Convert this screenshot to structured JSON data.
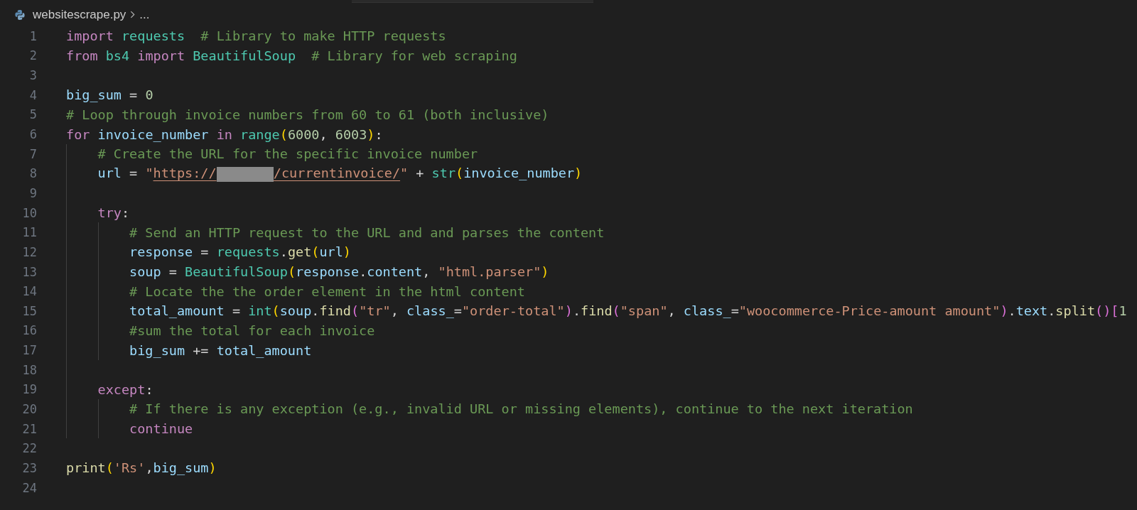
{
  "breadcrumb": {
    "file": "websitescrape.py",
    "more": "..."
  },
  "lines": [
    {
      "number": "1",
      "tokens": [
        {
          "kind": "kw",
          "text": "import "
        },
        {
          "kind": "cls",
          "text": "requests  "
        },
        {
          "kind": "comment",
          "text": "# Library to make HTTP requests"
        }
      ]
    },
    {
      "number": "2",
      "tokens": [
        {
          "kind": "kw",
          "text": "from "
        },
        {
          "kind": "cls",
          "text": "bs4 "
        },
        {
          "kind": "kw",
          "text": "import "
        },
        {
          "kind": "cls",
          "text": "BeautifulSoup  "
        },
        {
          "kind": "comment",
          "text": "# Library for web scraping"
        }
      ]
    },
    {
      "number": "3"
    },
    {
      "number": "4",
      "tokens": [
        {
          "kind": "var",
          "text": "big_sum"
        },
        {
          "kind": "plain",
          "text": " = "
        },
        {
          "kind": "num",
          "text": "0"
        }
      ]
    },
    {
      "number": "5",
      "tokens": [
        {
          "kind": "comment",
          "text": "# Loop through invoice numbers from 60 to 61 (both inclusive)"
        }
      ]
    },
    {
      "number": "6",
      "tokens": [
        {
          "kind": "kw",
          "text": "for "
        },
        {
          "kind": "var",
          "text": "invoice_number "
        },
        {
          "kind": "kw",
          "text": "in "
        },
        {
          "kind": "cls",
          "text": "range"
        },
        {
          "kind": "br1",
          "text": "("
        },
        {
          "kind": "num",
          "text": "6000"
        },
        {
          "kind": "plain",
          "text": ", "
        },
        {
          "kind": "num",
          "text": "6003"
        },
        {
          "kind": "br1",
          "text": ")"
        },
        {
          "kind": "plain",
          "text": ":"
        }
      ],
      "children": [
        {
          "number": "7",
          "tokens": [
            {
              "kind": "comment",
              "text": "# Create the URL for the specific invoice number"
            }
          ]
        },
        {
          "number": "8",
          "tokens": [
            {
              "kind": "var",
              "text": "url"
            },
            {
              "kind": "plain",
              "text": " = "
            },
            {
              "kind": "str",
              "text": "\""
            },
            {
              "kind": "url",
              "text": "https://"
            },
            {
              "kind": "redacted"
            },
            {
              "kind": "url",
              "text": "/currentinvoice/"
            },
            {
              "kind": "str",
              "text": "\""
            },
            {
              "kind": "plain",
              "text": " + "
            },
            {
              "kind": "cls",
              "text": "str"
            },
            {
              "kind": "br1",
              "text": "("
            },
            {
              "kind": "var",
              "text": "invoice_number"
            },
            {
              "kind": "br1",
              "text": ")"
            }
          ]
        },
        {
          "number": "9"
        },
        {
          "number": "10",
          "tokens": [
            {
              "kind": "kw",
              "text": "try"
            },
            {
              "kind": "plain",
              "text": ":"
            }
          ],
          "children": [
            {
              "number": "11",
              "tokens": [
                {
                  "kind": "comment",
                  "text": "# Send an HTTP request to the URL and and parses the content"
                }
              ]
            },
            {
              "number": "12",
              "tokens": [
                {
                  "kind": "var",
                  "text": "response"
                },
                {
                  "kind": "plain",
                  "text": " = "
                },
                {
                  "kind": "cls",
                  "text": "requests"
                },
                {
                  "kind": "plain",
                  "text": "."
                },
                {
                  "kind": "fn",
                  "text": "get"
                },
                {
                  "kind": "br1",
                  "text": "("
                },
                {
                  "kind": "var",
                  "text": "url"
                },
                {
                  "kind": "br1",
                  "text": ")"
                }
              ]
            },
            {
              "number": "13",
              "tokens": [
                {
                  "kind": "var",
                  "text": "soup"
                },
                {
                  "kind": "plain",
                  "text": " = "
                },
                {
                  "kind": "cls",
                  "text": "BeautifulSoup"
                },
                {
                  "kind": "br1",
                  "text": "("
                },
                {
                  "kind": "var",
                  "text": "response"
                },
                {
                  "kind": "plain",
                  "text": "."
                },
                {
                  "kind": "var",
                  "text": "content"
                },
                {
                  "kind": "plain",
                  "text": ", "
                },
                {
                  "kind": "str",
                  "text": "\"html.parser\""
                },
                {
                  "kind": "br1",
                  "text": ")"
                }
              ]
            },
            {
              "number": "14",
              "tokens": [
                {
                  "kind": "comment",
                  "text": "# Locate the the order element in the html content"
                }
              ]
            },
            {
              "number": "15",
              "tokens": [
                {
                  "kind": "var",
                  "text": "total_amount"
                },
                {
                  "kind": "plain",
                  "text": " = "
                },
                {
                  "kind": "cls",
                  "text": "int"
                },
                {
                  "kind": "br1",
                  "text": "("
                },
                {
                  "kind": "var",
                  "text": "soup"
                },
                {
                  "kind": "plain",
                  "text": "."
                },
                {
                  "kind": "fn",
                  "text": "find"
                },
                {
                  "kind": "br2",
                  "text": "("
                },
                {
                  "kind": "str",
                  "text": "\"tr\""
                },
                {
                  "kind": "plain",
                  "text": ", "
                },
                {
                  "kind": "var",
                  "text": "class_"
                },
                {
                  "kind": "plain",
                  "text": "="
                },
                {
                  "kind": "str",
                  "text": "\"order-total\""
                },
                {
                  "kind": "br2",
                  "text": ")"
                },
                {
                  "kind": "plain",
                  "text": "."
                },
                {
                  "kind": "fn",
                  "text": "find"
                },
                {
                  "kind": "br2",
                  "text": "("
                },
                {
                  "kind": "str",
                  "text": "\"span\""
                },
                {
                  "kind": "plain",
                  "text": ", "
                },
                {
                  "kind": "var",
                  "text": "class_"
                },
                {
                  "kind": "plain",
                  "text": "="
                },
                {
                  "kind": "str",
                  "text": "\"woocommerce-Price-amount amount\""
                },
                {
                  "kind": "br2",
                  "text": ")"
                },
                {
                  "kind": "plain",
                  "text": "."
                },
                {
                  "kind": "var",
                  "text": "text"
                },
                {
                  "kind": "plain",
                  "text": "."
                },
                {
                  "kind": "fn",
                  "text": "split"
                },
                {
                  "kind": "br2",
                  "text": "()["
                },
                {
                  "kind": "num",
                  "text": "1"
                }
              ]
            },
            {
              "number": "16",
              "tokens": [
                {
                  "kind": "comment",
                  "text": "#sum the total for each invoice"
                }
              ]
            },
            {
              "number": "17",
              "tokens": [
                {
                  "kind": "var",
                  "text": "big_sum"
                },
                {
                  "kind": "plain",
                  "text": " += "
                },
                {
                  "kind": "var",
                  "text": "total_amount"
                }
              ]
            }
          ]
        },
        {
          "number": "18"
        },
        {
          "number": "19",
          "tokens": [
            {
              "kind": "kw",
              "text": "except"
            },
            {
              "kind": "plain",
              "text": ":"
            }
          ],
          "children": [
            {
              "number": "20",
              "tokens": [
                {
                  "kind": "comment",
                  "text": "# If there is any exception (e.g., invalid URL or missing elements), continue to the next iteration"
                }
              ]
            },
            {
              "number": "21",
              "tokens": [
                {
                  "kind": "kw",
                  "text": "continue"
                }
              ]
            }
          ]
        }
      ]
    },
    {
      "number": "22"
    },
    {
      "number": "23",
      "tokens": [
        {
          "kind": "fn",
          "text": "print"
        },
        {
          "kind": "br1",
          "text": "("
        },
        {
          "kind": "str",
          "text": "'Rs'"
        },
        {
          "kind": "plain",
          "text": ","
        },
        {
          "kind": "var",
          "text": "big_sum"
        },
        {
          "kind": "br1",
          "text": ")"
        }
      ]
    },
    {
      "number": "24"
    }
  ]
}
